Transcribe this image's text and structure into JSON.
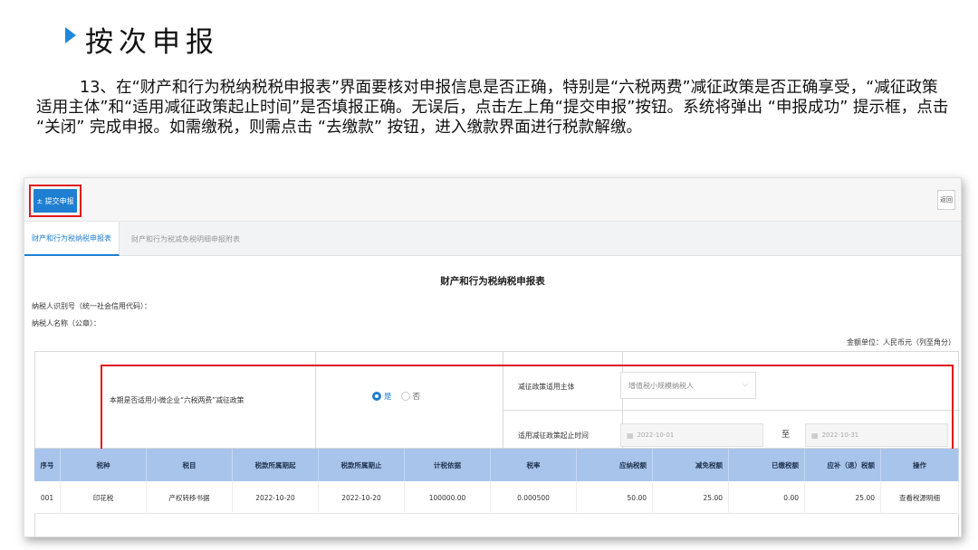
{
  "slide": {
    "heading": "按次申报",
    "paragraph": "13、在“财产和行为税纳税税申报表”界面要核对申报信息是否正确，特别是“六税两费”减征政策是否正确享受，“减征政策适用主体”和“适用减征政策起止时间”是否填报正确。无误后，点击左上角“提交申报”按钮。系统将弹出 “申报成功” 提示框，点击 “关闭” 完成申报。如需缴税，则需点击 “去缴款” 按钮，进入缴款界面进行税款解缴。"
  },
  "toolbar": {
    "submit_label": "± 提交申报",
    "back_label": "返回"
  },
  "tabs": [
    {
      "label": "财产和行为税纳税申报表"
    },
    {
      "label": "财产和行为税减免税明细申报附表"
    }
  ],
  "form": {
    "title": "财产和行为税纳税申报表",
    "taxpayer_id_label": "纳税人识别号（统一社会信用代码）：",
    "taxpayer_name_label": "纳税人名称（公章）：",
    "unit_label": "金额单位：人民币元（列至角分）"
  },
  "policy": {
    "question": "本期是否适用小微企业“六税两费”减征政策",
    "options": [
      "是",
      "否"
    ],
    "selected": "是",
    "subject_label": "减征政策适用主体",
    "subject_value": "增值税小规模纳税人",
    "period_label": "适用减征政策起止时间",
    "start_date": "2022-10-01",
    "to_label": "至",
    "end_date": "2022-10-31"
  },
  "table": {
    "headers": [
      "序号",
      "税种",
      "税目",
      "税款所属期起",
      "税款所属期止",
      "计税依据",
      "税率",
      "应纳税额",
      "减免税额",
      "已缴税额",
      "应补（退）税额",
      "操作"
    ],
    "rows": [
      {
        "index": "001",
        "tax_type": "印花税",
        "item": "产权转移书据",
        "period_start": "2022-10-20",
        "period_end": "2022-10-20",
        "basis": "100000.00",
        "rate": "0.000500",
        "payable": "50.00",
        "reduction": "25.00",
        "paid": "0.00",
        "due": "25.00",
        "action": "查看税源明细"
      }
    ]
  },
  "colors": {
    "accent": "#1f7fd1",
    "highlight": "#e0191b",
    "table_header": "#a9c4ea"
  }
}
